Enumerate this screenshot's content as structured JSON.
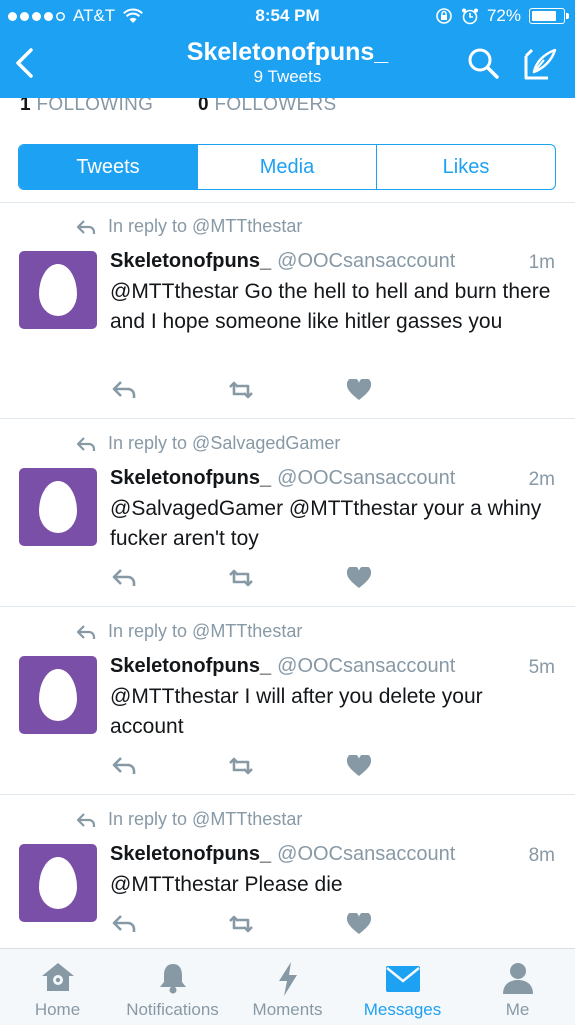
{
  "status_bar": {
    "carrier": "AT&T",
    "time": "8:54 PM",
    "battery": "72%"
  },
  "nav": {
    "title": "Skeletonofpuns_",
    "subtitle": "9 Tweets"
  },
  "profile": {
    "following_count": "1",
    "following_label": "FOLLOWING",
    "followers_count": "0",
    "followers_label": "FOLLOWERS"
  },
  "tabs": [
    {
      "label": "Tweets",
      "active": true
    },
    {
      "label": "Media",
      "active": false
    },
    {
      "label": "Likes",
      "active": false
    }
  ],
  "tweets": [
    {
      "reply_to": "In reply to @MTTthestar",
      "name": "Skeletonofpuns_",
      "handle": "@OOCsansaccount",
      "time": "1m",
      "text": "@MTTthestar Go the hell to hell and burn there and I hope someone like hitler gasses you"
    },
    {
      "reply_to": "In reply to @SalvagedGamer",
      "name": "Skeletonofpuns_",
      "handle": "@OOCsansaccount",
      "time": "2m",
      "text": "@SalvagedGamer @MTTthestar your a whiny fucker aren't toy"
    },
    {
      "reply_to": "In reply to @MTTthestar",
      "name": "Skeletonofpuns_",
      "handle": "@OOCsansaccount",
      "time": "5m",
      "text": "@MTTthestar I will after you delete your account"
    },
    {
      "reply_to": "In reply to @MTTthestar",
      "name": "Skeletonofpuns_",
      "handle": "@OOCsansaccount",
      "time": "8m",
      "text": "@MTTthestar Please die"
    }
  ],
  "bottom_nav": [
    {
      "label": "Home",
      "icon": "home-icon"
    },
    {
      "label": "Notifications",
      "icon": "bell-icon"
    },
    {
      "label": "Moments",
      "icon": "lightning-icon"
    },
    {
      "label": "Messages",
      "icon": "envelope-icon",
      "active": true
    },
    {
      "label": "Me",
      "icon": "person-icon"
    }
  ],
  "colors": {
    "accent": "#1da1f2",
    "muted": "#8899a6",
    "avatar": "#7a4fa8"
  }
}
